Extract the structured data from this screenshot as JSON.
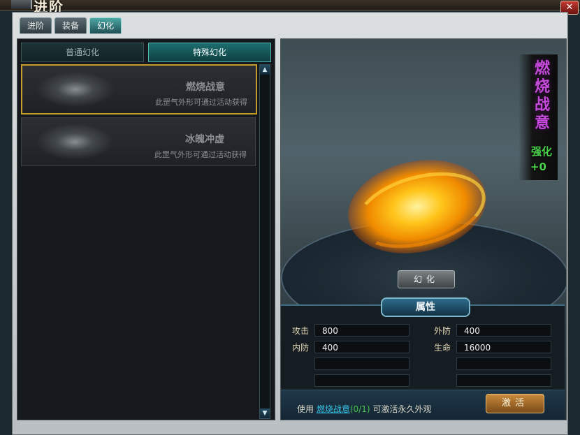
{
  "window": {
    "title": "进阶",
    "close_symbol": "✕"
  },
  "tabs": [
    {
      "label": "进阶",
      "active": false
    },
    {
      "label": "装备",
      "active": false
    },
    {
      "label": "幻化",
      "active": true
    }
  ],
  "subtabs": {
    "normal_label": "普通幻化",
    "special_label": "特殊幻化",
    "active": "special"
  },
  "items": [
    {
      "name": "燃烧战意",
      "desc": "此罡气外形可通过活动获得",
      "selected": true
    },
    {
      "name": "冰魄冲虚",
      "desc": "此罡气外形可通过活动获得",
      "selected": false
    }
  ],
  "scroll": {
    "up_icon": "▲",
    "down_icon": "▼"
  },
  "preview": {
    "name": "燃烧战意",
    "enhance_label": "强化",
    "enhance_value": "+0",
    "transform_button": "幻化"
  },
  "attributes": {
    "title": "属性",
    "rows": [
      {
        "label": "攻击",
        "value": "800"
      },
      {
        "label": "外防",
        "value": "400"
      },
      {
        "label": "内防",
        "value": "400"
      },
      {
        "label": "生命",
        "value": "16000"
      }
    ]
  },
  "activate": {
    "prefix": "使用",
    "item_link": "燃烧战意",
    "count": "(0/1)",
    "suffix": "可激活永久外观",
    "button": "激活"
  },
  "colors": {
    "accent_teal": "#1d6e6f",
    "selected_gold": "#c79d2a",
    "name_purple": "#c64bdc",
    "enhance_green": "#4bd04b",
    "link_cyan": "#38c6e8"
  }
}
